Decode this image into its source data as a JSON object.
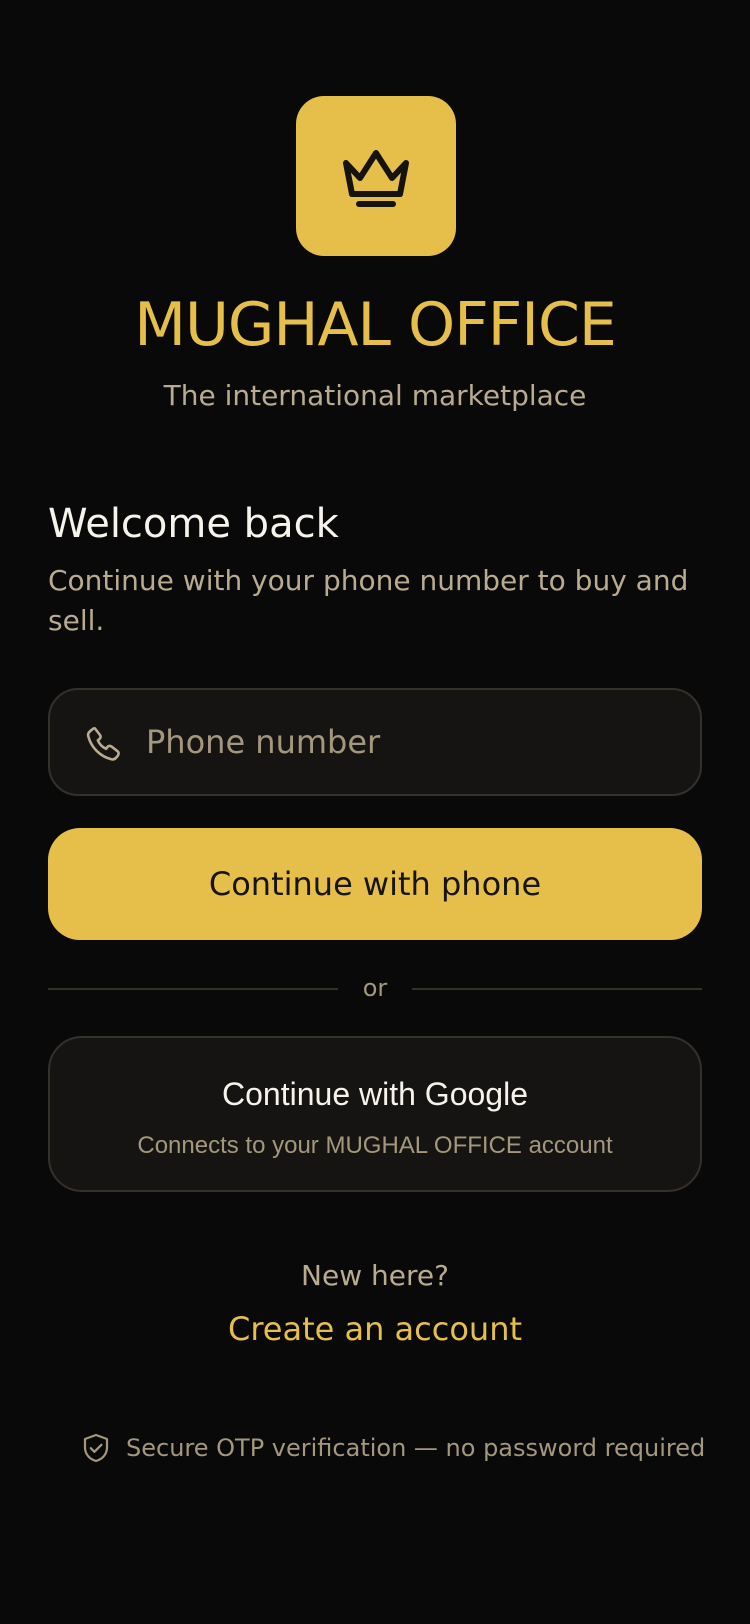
{
  "brand": {
    "name": "MUGHAL OFFICE",
    "tagline": "The international marketplace",
    "icon": "crown-icon",
    "accent_color": "#e6bf4a"
  },
  "welcome": {
    "title": "Welcome back",
    "description": "Continue with your phone number to buy and sell."
  },
  "phone_field": {
    "icon": "phone-icon",
    "placeholder": "Phone number",
    "value": ""
  },
  "buttons": {
    "continue_phone": "Continue with phone",
    "continue_google": "Continue with Google",
    "google_subtext": "Connects to your MUGHAL OFFICE account"
  },
  "divider": {
    "label": "or"
  },
  "signup": {
    "prompt": "New here?",
    "link": "Create an account"
  },
  "security_note": {
    "icon": "shield-check-icon",
    "text": "Secure OTP verification — no password required"
  },
  "colors": {
    "background": "#0a0909",
    "surface": "#161412",
    "border": "#34302a",
    "muted_text": "#b8ab8f"
  }
}
